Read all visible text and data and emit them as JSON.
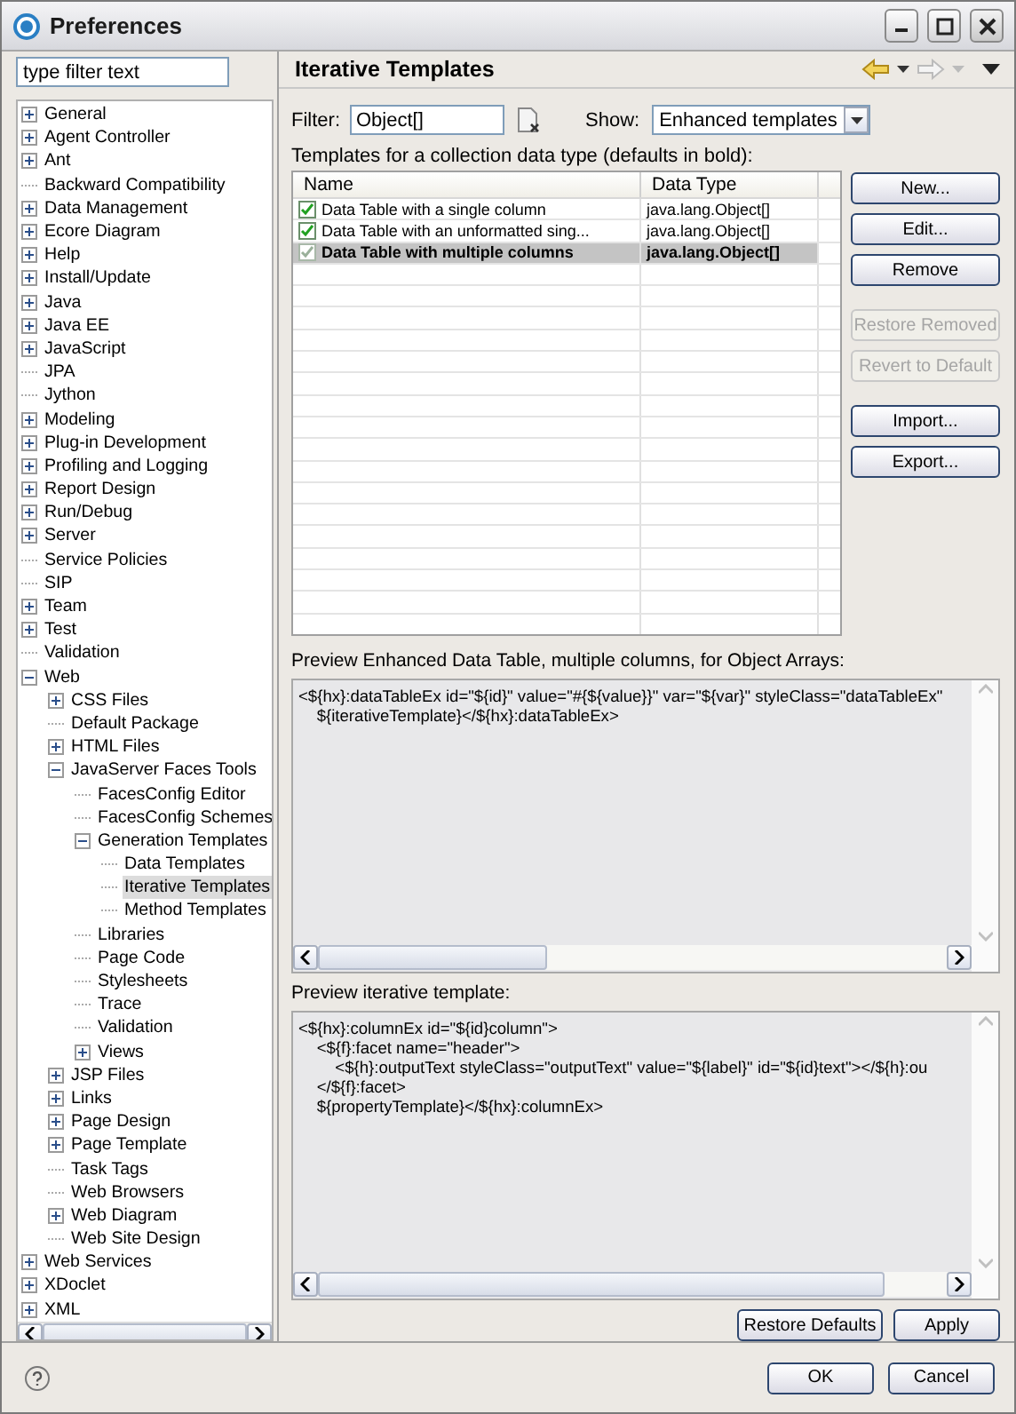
{
  "window": {
    "title": "Preferences"
  },
  "sidebar": {
    "filter": {
      "placeholder": "type filter text"
    },
    "items": [
      {
        "label": "General",
        "expanded": false,
        "selected": false
      },
      {
        "label": "Agent Controller",
        "expanded": false,
        "selected": false
      },
      {
        "label": "Ant",
        "expanded": false,
        "selected": false
      },
      {
        "label": "Backward Compatibility",
        "selected": false
      },
      {
        "label": "Data Management",
        "expanded": false,
        "selected": false
      },
      {
        "label": "Ecore Diagram",
        "expanded": false,
        "selected": false
      },
      {
        "label": "Help",
        "expanded": false,
        "selected": false
      },
      {
        "label": "Install/Update",
        "expanded": false,
        "selected": false
      },
      {
        "label": "Java",
        "expanded": false,
        "selected": false
      },
      {
        "label": "Java EE",
        "expanded": false,
        "selected": false
      },
      {
        "label": "JavaScript",
        "expanded": false,
        "selected": false
      },
      {
        "label": "JPA",
        "selected": false
      },
      {
        "label": "Jython",
        "selected": false
      },
      {
        "label": "Modeling",
        "expanded": false,
        "selected": false
      },
      {
        "label": "Plug-in Development",
        "expanded": false,
        "selected": false
      },
      {
        "label": "Profiling and Logging",
        "expanded": false,
        "selected": false
      },
      {
        "label": "Report Design",
        "expanded": false,
        "selected": false
      },
      {
        "label": "Run/Debug",
        "expanded": false,
        "selected": false
      },
      {
        "label": "Server",
        "expanded": false,
        "selected": false
      },
      {
        "label": "Service Policies",
        "selected": false
      },
      {
        "label": "SIP",
        "selected": false
      },
      {
        "label": "Team",
        "expanded": false,
        "selected": false
      },
      {
        "label": "Test",
        "expanded": false,
        "selected": false
      },
      {
        "label": "Validation",
        "selected": false
      },
      {
        "label": "Web",
        "expanded": true,
        "selected": false,
        "children": [
          {
            "label": "CSS Files",
            "expanded": false,
            "selected": false
          },
          {
            "label": "Default Package",
            "selected": false
          },
          {
            "label": "HTML Files",
            "expanded": false,
            "selected": false
          },
          {
            "label": "JavaServer Faces Tools",
            "expanded": true,
            "selected": false,
            "children": [
              {
                "label": "FacesConfig Editor",
                "selected": false
              },
              {
                "label": "FacesConfig Schemes",
                "selected": false
              },
              {
                "label": "Generation Templates",
                "expanded": true,
                "selected": false,
                "children": [
                  {
                    "label": "Data Templates",
                    "selected": false
                  },
                  {
                    "label": "Iterative Templates",
                    "selected": true
                  },
                  {
                    "label": "Method Templates",
                    "selected": false
                  }
                ]
              },
              {
                "label": "Libraries",
                "selected": false
              },
              {
                "label": "Page Code",
                "selected": false
              },
              {
                "label": "Stylesheets",
                "selected": false
              },
              {
                "label": "Trace",
                "selected": false
              },
              {
                "label": "Validation",
                "selected": false
              },
              {
                "label": "Views",
                "expanded": false,
                "selected": false
              }
            ]
          },
          {
            "label": "JSP Files",
            "expanded": false,
            "selected": false
          },
          {
            "label": "Links",
            "expanded": false,
            "selected": false
          },
          {
            "label": "Page Design",
            "expanded": false,
            "selected": false
          },
          {
            "label": "Page Template",
            "expanded": false,
            "selected": false
          },
          {
            "label": "Task Tags",
            "selected": false
          },
          {
            "label": "Web Browsers",
            "selected": false
          },
          {
            "label": "Web Diagram",
            "expanded": false,
            "selected": false
          },
          {
            "label": "Web Site Design",
            "selected": false
          }
        ]
      },
      {
        "label": "Web Services",
        "expanded": false,
        "selected": false
      },
      {
        "label": "XDoclet",
        "expanded": false,
        "selected": false
      },
      {
        "label": "XML",
        "expanded": false,
        "selected": false
      }
    ]
  },
  "page": {
    "title": "Iterative Templates",
    "filter": {
      "label": "Filter:",
      "value": "Object[]"
    },
    "show": {
      "label": "Show:",
      "value": "Enhanced templates"
    },
    "table_caption": "Templates for a collection data type (defaults in bold):",
    "table": {
      "columns": [
        "Name",
        "Data Type"
      ],
      "rows": [
        {
          "name": "Data Table with a single column",
          "data_type": "java.lang.Object[]",
          "checked": true,
          "default": false,
          "selected": false
        },
        {
          "name": "Data Table with an unformatted sing...",
          "data_type": "java.lang.Object[]",
          "checked": true,
          "default": false,
          "selected": false
        },
        {
          "name": "Data Table with multiple columns",
          "data_type": "java.lang.Object[]",
          "checked": true,
          "default": true,
          "selected": true
        }
      ]
    },
    "side_button_groups": [
      [
        {
          "label": "New...",
          "disabled": false
        },
        {
          "label": "Edit...",
          "disabled": false
        },
        {
          "label": "Remove",
          "disabled": false
        }
      ],
      [
        {
          "label": "Restore Removed",
          "disabled": true
        },
        {
          "label": "Revert to Default",
          "disabled": true
        }
      ],
      [
        {
          "label": "Import...",
          "disabled": false
        },
        {
          "label": "Export...",
          "disabled": false
        }
      ]
    ],
    "preview": {
      "label": "Preview Enhanced Data Table, multiple columns, for Object Arrays:",
      "lines": [
        "<${hx}:dataTableEx id=\"${id}\" value=\"#{${value}}\" var=\"${var}\" styleClass=\"dataTableEx\"",
        "    ${iterativeTemplate}</${hx}:dataTableEx>"
      ]
    },
    "iterative_preview": {
      "label": "Preview iterative template:",
      "lines": [
        "<${hx}:columnEx id=\"${id}column\">",
        "    <${f}:facet name=\"header\">",
        "        <${h}:outputText styleClass=\"outputText\" value=\"${label}\" id=\"${id}text\"></${h}:ou",
        "    </${f}:facet>",
        "    ${propertyTemplate}</${hx}:columnEx>"
      ]
    },
    "page_buttons": [
      "Restore Defaults",
      "Apply"
    ]
  },
  "dialog_buttons": [
    "OK",
    "Cancel"
  ]
}
